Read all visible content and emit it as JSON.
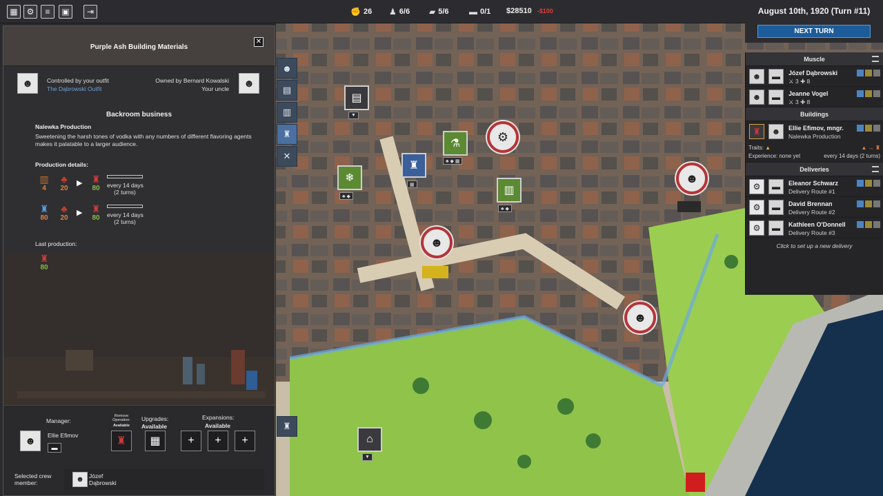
{
  "topbar": {
    "buttons": [
      {
        "name": "city-overview-button",
        "glyph": "▦"
      },
      {
        "name": "gangs-button",
        "glyph": "⚙"
      },
      {
        "name": "ledger-button",
        "glyph": "≡"
      },
      {
        "name": "files-button",
        "glyph": "▣"
      },
      {
        "name": "exit-button",
        "glyph": "⇥"
      }
    ],
    "stats": {
      "influence": "26",
      "crew": "6/6",
      "buildings": "5/6",
      "vehicles": "0/1",
      "money": "$28510",
      "money_change": "-$100"
    }
  },
  "date": "August 10th, 1920 (Turn #11)",
  "next_turn_label": "NEXT TURN",
  "building_panel": {
    "title": "Purple Ash Building Materials",
    "controlled_by_label": "Controlled by your outfit",
    "outfit_name": "The Dąbrowski Outfit",
    "owned_by_label": "Owned by Bernard Kowalski",
    "owner_relation": "Your uncle",
    "section_title": "Backroom business",
    "business_name": "Nalewka Production",
    "description": "Sweetening the harsh tones of vodka with any numbers of different flavoring agents makes it palatable to a larger audience.",
    "production_details_label": "Production details:",
    "recipes": [
      {
        "in1": "4",
        "in2": "20",
        "out": "80",
        "every": "every 14 days",
        "turns": "(2 turns)"
      },
      {
        "in1": "80",
        "in2": "20",
        "out": "80",
        "every": "every 14 days",
        "turns": "(2 turns)"
      }
    ],
    "last_production_label": "Last production:",
    "last_production_value": "80",
    "footer": {
      "manager_label": "Manager:",
      "manager_name": "Ellie Efimov",
      "remove_label": "Remove Operation:",
      "remove_state": "Available",
      "upgrades_label": "Upgrades:",
      "upgrades_state": "Available",
      "expansions_label": "Expansions:",
      "expansions_state": "Available",
      "selected_crew_label_1": "Selected crew",
      "selected_crew_label_2": "member:",
      "selected_crew_first": "Józef",
      "selected_crew_last": "Dąbrowski"
    }
  },
  "right_panel": {
    "muscle_title": "Muscle",
    "muscle": [
      {
        "name": "Józef Dąbrowski",
        "stats": "⚔ 3  ✚ 8"
      },
      {
        "name": "Jeanne Vogel",
        "stats": "⚔ 3  ✚ 8"
      }
    ],
    "buildings_title": "Buildings",
    "building_entry": {
      "name": "Ellie Efimov, mngr.",
      "business": "Nalewka Production",
      "traits_label": "Traits:",
      "experience": "Experience: none yet",
      "cycle": "every 14 days (2 turns)"
    },
    "deliveries_title": "Deliveries",
    "deliveries": [
      {
        "name": "Eleanor Schwarz",
        "route": "Delivery Route #1"
      },
      {
        "name": "David Brennan",
        "route": "Delivery Route #2"
      },
      {
        "name": "Kathleen O'Donnell",
        "route": "Delivery Route #3"
      }
    ],
    "new_delivery_hint": "Click to set up a new delivery"
  },
  "colors": {
    "accent_blue": "#1d5c9a",
    "money_negative": "#e03a3a",
    "input_amount": "#e0813c",
    "output_amount": "#8ab84a",
    "link": "#6fa0d6"
  }
}
